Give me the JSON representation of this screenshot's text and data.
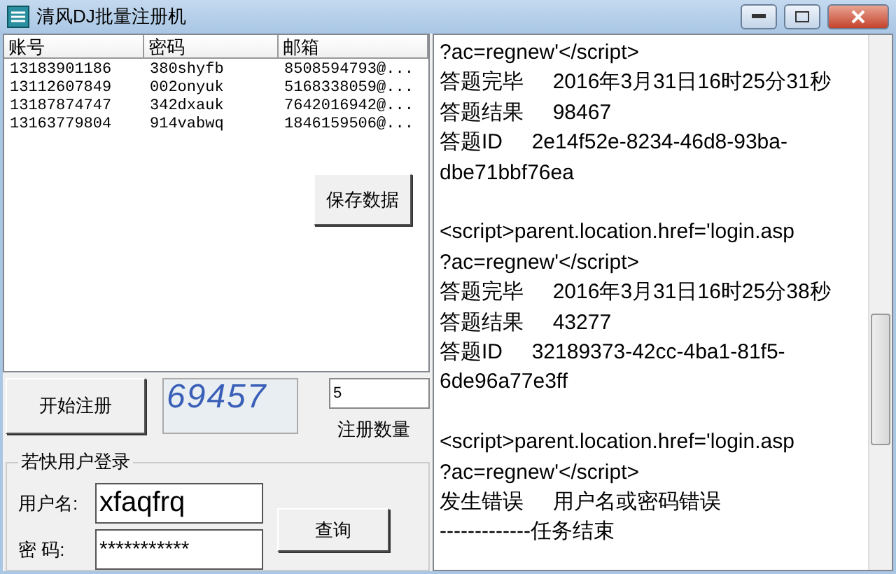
{
  "window": {
    "title": "清风DJ批量注册机"
  },
  "table": {
    "columns": [
      "账号",
      "密码",
      "邮箱"
    ],
    "rows": [
      [
        "13183901186",
        "380shyfb",
        "8508594793@..."
      ],
      [
        "13112607849",
        "002onyuk",
        "5168338059@..."
      ],
      [
        "13187874747",
        "342dxauk",
        "7642016942@..."
      ],
      [
        "13163779804",
        "914vabwq",
        "1846159506@..."
      ]
    ]
  },
  "save_button": "保存数据",
  "start_button": "开始注册",
  "captcha": "69457",
  "count": {
    "value": "5",
    "label": "注册数量"
  },
  "login_group": {
    "title": "若快用户登录",
    "username_label": "用户名:",
    "username": "xfaqfrq",
    "password_label": "密 码:",
    "password": "***********",
    "query_button": "查询"
  },
  "log": [
    {
      "kind": "text",
      "text": "?ac=regnew'</script>"
    },
    {
      "kind": "text",
      "text": "答题完毕     2016年3月31日16时25分31秒"
    },
    {
      "kind": "text",
      "text": "答题结果     98467"
    },
    {
      "kind": "text",
      "text": "答题ID     2e14f52e-8234-46d8-93ba-"
    },
    {
      "kind": "text",
      "text": "dbe71bbf76ea"
    },
    {
      "kind": "gap"
    },
    {
      "kind": "text",
      "text": "<script>parent.location.href='login.asp"
    },
    {
      "kind": "text",
      "text": "?ac=regnew'</script>"
    },
    {
      "kind": "text",
      "text": "答题完毕     2016年3月31日16时25分38秒"
    },
    {
      "kind": "text",
      "text": "答题结果     43277"
    },
    {
      "kind": "text",
      "text": "答题ID     32189373-42cc-4ba1-81f5-"
    },
    {
      "kind": "text",
      "text": "6de96a77e3ff"
    },
    {
      "kind": "gap"
    },
    {
      "kind": "text",
      "text": "<script>parent.location.href='login.asp"
    },
    {
      "kind": "text",
      "text": "?ac=regnew'</script>"
    },
    {
      "kind": "text",
      "text": "发生错误     用户名或密码错误"
    },
    {
      "kind": "text",
      "text": "-------------任务结束"
    }
  ]
}
